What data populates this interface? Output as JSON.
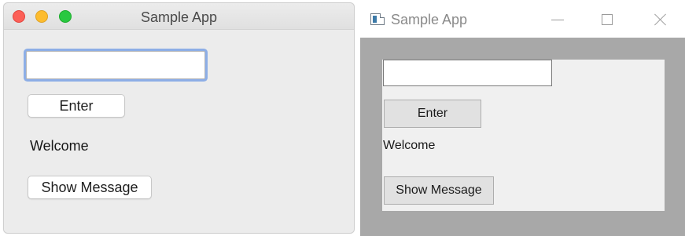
{
  "mac_window": {
    "title": "Sample App",
    "input_value": "",
    "enter_button_label": "Enter",
    "welcome_label": "Welcome",
    "show_message_button_label": "Show Message"
  },
  "win_window": {
    "title": "Sample App",
    "icon": "application-window-icon",
    "input_value": "",
    "enter_button_label": "Enter",
    "welcome_label": "Welcome",
    "show_message_button_label": "Show Message"
  },
  "colors": {
    "mac_close": "#fc5f57",
    "mac_minimize": "#fdbc2e",
    "mac_zoom": "#29c840",
    "mac_focus_ring": "#8daee6",
    "win_background": "#a8a8a8",
    "win_panel": "#f0f0f0"
  }
}
